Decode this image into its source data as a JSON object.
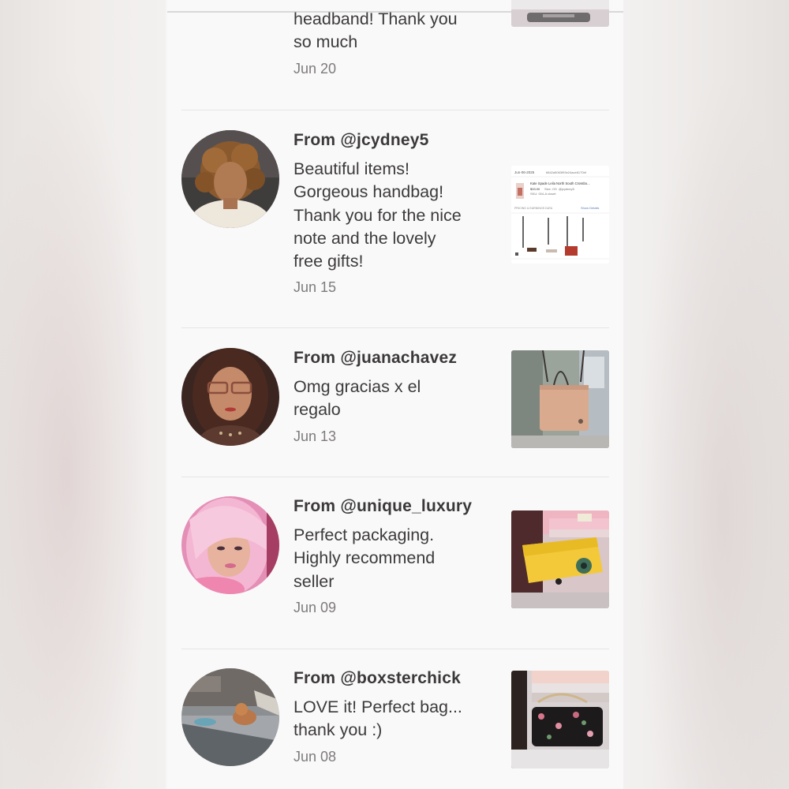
{
  "reviews": [
    {
      "from": "",
      "comment_lines": [
        "headband! Thank you",
        "so much"
      ],
      "date": "Jun 20",
      "avatar": "none",
      "thumbnail": "purchased-item-photo"
    },
    {
      "from": "From @jcydney5",
      "comment_lines": [
        "Beautiful items!",
        "Gorgeous handbag!",
        "Thank you for the nice",
        "note and the lovely",
        "free gifts!"
      ],
      "date": "Jun 15",
      "avatar": "user-avatar-jcydney5",
      "thumbnail": "order-receipt-screenshot"
    },
    {
      "from": "From @juanachavez",
      "comment_lines": [
        "Omg gracias x el",
        "regalo"
      ],
      "date": "Jun 13",
      "avatar": "user-avatar-juanachavez",
      "thumbnail": "tan-tote-bag-photo"
    },
    {
      "from": "From @unique_luxury",
      "comment_lines": [
        "Perfect packaging.",
        "Highly recommend",
        "seller"
      ],
      "date": "Jun 09",
      "avatar": "user-avatar-unique-luxury",
      "thumbnail": "yellow-crossbody-bag-photo"
    },
    {
      "from": "From @boxsterchick",
      "comment_lines": [
        "LOVE it! Perfect bag...",
        "thank you :)"
      ],
      "date": "Jun 08",
      "avatar": "user-avatar-boxsterchick",
      "thumbnail": "floral-chain-bag-photo"
    }
  ],
  "receipt": {
    "date": "Jun-06-2025",
    "order_id": "6842a5063f93e24ace6170bf",
    "item_title": "Kate Spade Leila North South Crossbo...",
    "price": "$33.00",
    "size": "Size: OS",
    "buyer": "@jcydney5",
    "sku": "SKU: 004-A closet",
    "section_label": "PRICING & EARNINGS DATA",
    "link_label": "Show Details"
  },
  "colors": {
    "panel_background": "#faf9f9",
    "text": "#3c3a3a",
    "date_text": "#7d7a7a",
    "divider": "#e6e4e4"
  }
}
